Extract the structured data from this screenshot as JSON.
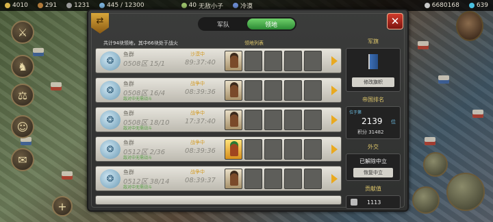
{
  "topbar": {
    "left": [
      "4010",
      "291",
      "1231",
      "445 / 12300"
    ],
    "center": [
      "40",
      "无敌小子",
      "冷漠"
    ],
    "right": [
      "6680168",
      "639"
    ]
  },
  "panel": {
    "tabs": [
      {
        "label": "军队",
        "active": false
      },
      {
        "label": "领地",
        "active": true
      }
    ],
    "summary": "共计94块领地，其中66块处于战火",
    "list_header": "领地列表",
    "rows": [
      {
        "name": "鱼群",
        "coord": "0508区 15/1",
        "sub": "",
        "status": "沙漠中",
        "timer": "89:37:40",
        "hero": "normal"
      },
      {
        "name": "鱼群",
        "coord": "0508区 16/4",
        "sub": "敌对中无需战斗",
        "status": "战争中",
        "timer": "08:39:36",
        "hero": "normal"
      },
      {
        "name": "鱼群",
        "coord": "0508区 18/10",
        "sub": "敌对中无需战斗",
        "status": "战争中",
        "timer": "17:37:40",
        "hero": "normal"
      },
      {
        "name": "鱼群",
        "coord": "0512区 2/36",
        "sub": "敌对中无需战斗",
        "status": "战争中",
        "timer": "08:39:36",
        "hero": "gold"
      },
      {
        "name": "鱼群",
        "coord": "0512区 38/14",
        "sub": "敌对中无需战斗",
        "status": "战争中",
        "timer": "08:39:37",
        "hero": "normal"
      }
    ],
    "right": {
      "flag_title": "军旗",
      "flag_button": "修改旗帜",
      "rank_title": "帝国排名",
      "rank_label": "位于第",
      "rank_value": "2139",
      "rank_unit": "位",
      "rank_score": "积分 31482",
      "dip_title": "外交",
      "dip_status": "已解除中立",
      "dip_button": "恢复中立",
      "contrib_title": "贡献值",
      "contrib_value": "1113"
    }
  },
  "colors": {
    "tab_active": "#3fae43",
    "close": "#c0321f",
    "accent": "#e9a91f"
  }
}
